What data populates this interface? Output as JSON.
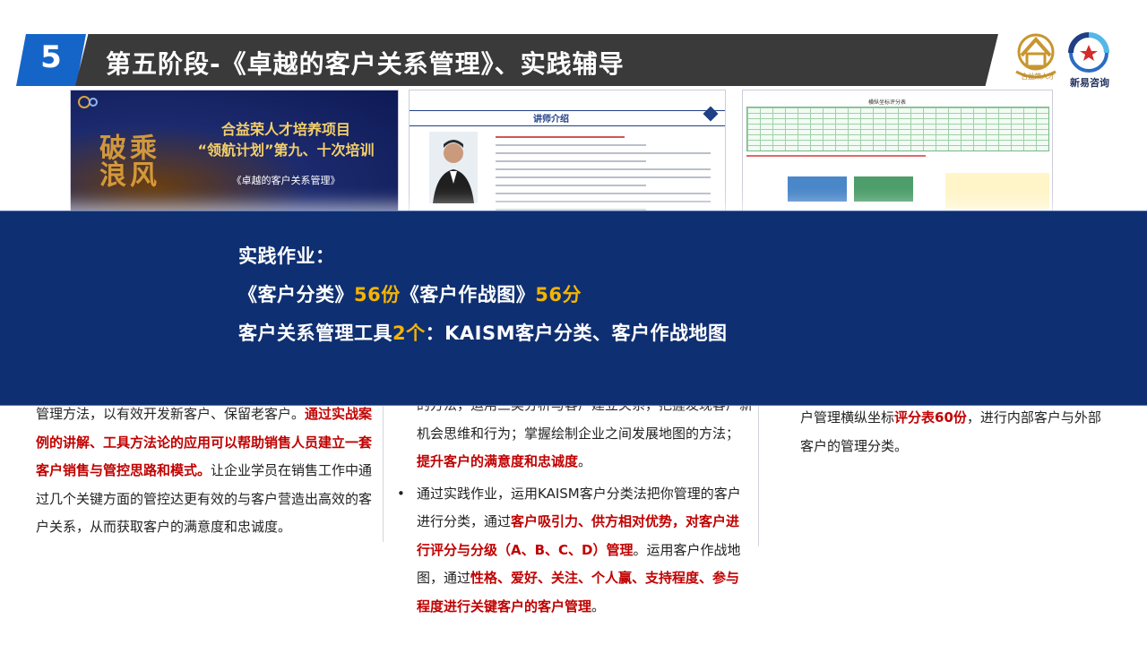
{
  "header": {
    "stage_number": "5",
    "title": "第五阶段-《卓越的客户关系管理》、实践辅导",
    "logo_left_caption": "合益荣人才",
    "logo_right_caption": "新易咨询"
  },
  "thumbnails": {
    "cover": {
      "line1": "合益荣人才培养项目",
      "line2": "“领航计划”第九、十次培训",
      "line3": "《卓越的客户关系管理》",
      "calligraphy": "乘风破浪"
    },
    "instructor": {
      "heading": "讲师介绍"
    },
    "table_slide": {
      "heading": "横纵坐标评分表"
    }
  },
  "overlay": {
    "line1": "实践作业：",
    "line2_part1": "《客户分类》",
    "line2_num1": "56份",
    "line2_part2": "《客户作战图》",
    "line2_num2": "56分",
    "line3_part1": "客户关系管理工具",
    "line3_num": "2个",
    "line3_part2": "：KAISM客户分类、客户作战地图"
  },
  "col1": {
    "t1": "管理方法，以有效开发新客户、保留老客户。",
    "h1": "通过实战案例的讲解、工具方法论的应用可以帮助销售人员建立一套客户销售与管控思路和模式。",
    "t2": "让企业学员在销售工作中通过几个关键方面的管控达更有效的与客户营造出高效的客户关系，从而获取客户的满意度和忠诚度。"
  },
  "col2": {
    "t0": "的方法，运用三类分析与客户建立关系，把握发现客户新机会思维和行为；掌握绘制企业之间发展地图的方法；",
    "h0": "提升客户的满意度和忠诚度",
    "t0b": "。",
    "bullet": "•",
    "t1": "通过实践作业，运用KAISM客户分类法把你管理的客户进行分类，通过",
    "h1": "客户吸引力、供方相对优势，对客户进行评分与分级（A、B、C、D）管理",
    "t2": "。运用客户作战地图，通过",
    "h2": "性格、爱好、关注、个人赢、支持程度、参与程度进行关键客户的客户管理",
    "t3": "。"
  },
  "col3": {
    "t1": "户管理横纵坐标",
    "h1": "评分表60份",
    "t2": "，进行内部客户与外部客户的管理分类。"
  },
  "colors": {
    "brand_blue": "#1565c8",
    "title_bar": "#3a3a3a",
    "overlay_bg": "#0e2f72",
    "highlight_gold": "#f6b400",
    "highlight_red": "#c00000"
  }
}
